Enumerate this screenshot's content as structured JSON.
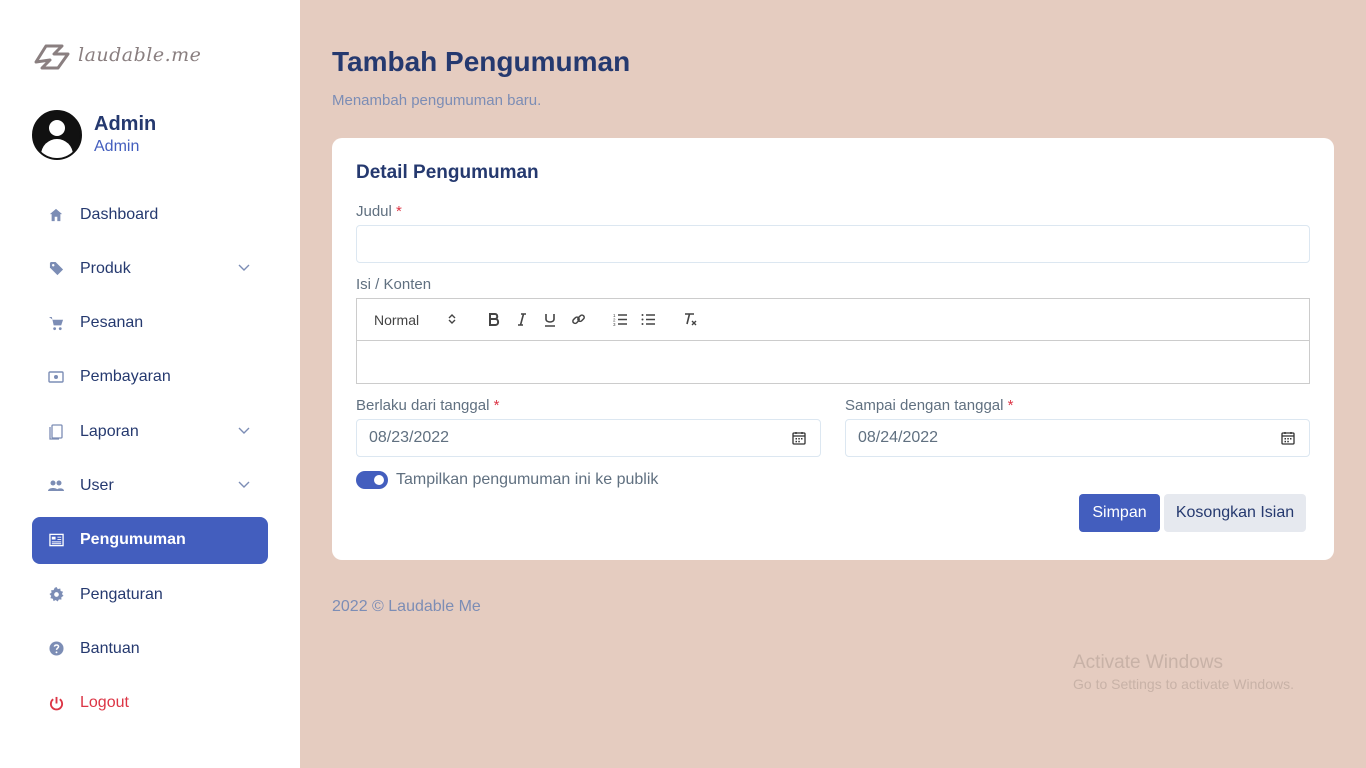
{
  "brand": {
    "logo_text": "laudable.me"
  },
  "profile": {
    "name": "Admin",
    "role": "Admin"
  },
  "menu": [
    {
      "label": "Dashboard",
      "icon": "home-icon",
      "chevron": false
    },
    {
      "label": "Produk",
      "icon": "tag-icon",
      "chevron": true
    },
    {
      "label": "Pesanan",
      "icon": "cart-icon",
      "chevron": false
    },
    {
      "label": "Pembayaran",
      "icon": "cash-icon",
      "chevron": false
    },
    {
      "label": "Laporan",
      "icon": "document-icon",
      "chevron": true
    },
    {
      "label": "User",
      "icon": "users-icon",
      "chevron": true
    },
    {
      "label": "Pengumuman",
      "icon": "newspaper-icon",
      "chevron": false,
      "active": true
    },
    {
      "label": "Pengaturan",
      "icon": "gear-icon",
      "chevron": false
    },
    {
      "label": "Bantuan",
      "icon": "question-icon",
      "chevron": false
    },
    {
      "label": "Logout",
      "icon": "power-icon",
      "chevron": false
    }
  ],
  "page": {
    "title": "Tambah Pengumuman",
    "subtitle": "Menambah pengumuman baru."
  },
  "form": {
    "card_title": "Detail Pengumuman",
    "title_label": "Judul",
    "title_value": "",
    "content_label": "Isi / Konten",
    "editor_format": "Normal",
    "start_label": "Berlaku dari tanggal",
    "start_value": "08/23/2022",
    "end_label": "Sampai dengan tanggal",
    "end_value": "08/24/2022",
    "required_mark": "*",
    "public_toggle_label": "Tampilkan pengumuman ini ke publik",
    "public_toggle_on": true,
    "save_label": "Simpan",
    "reset_label": "Kosongkan Isian"
  },
  "footer": {
    "text": "2022 © Laudable Me"
  },
  "watermark": {
    "title": "Activate Windows",
    "subtitle": "Go to Settings to activate Windows."
  },
  "colors": {
    "accent": "#435ebe",
    "background": "#e5ccc0",
    "danger": "#dc3545"
  }
}
